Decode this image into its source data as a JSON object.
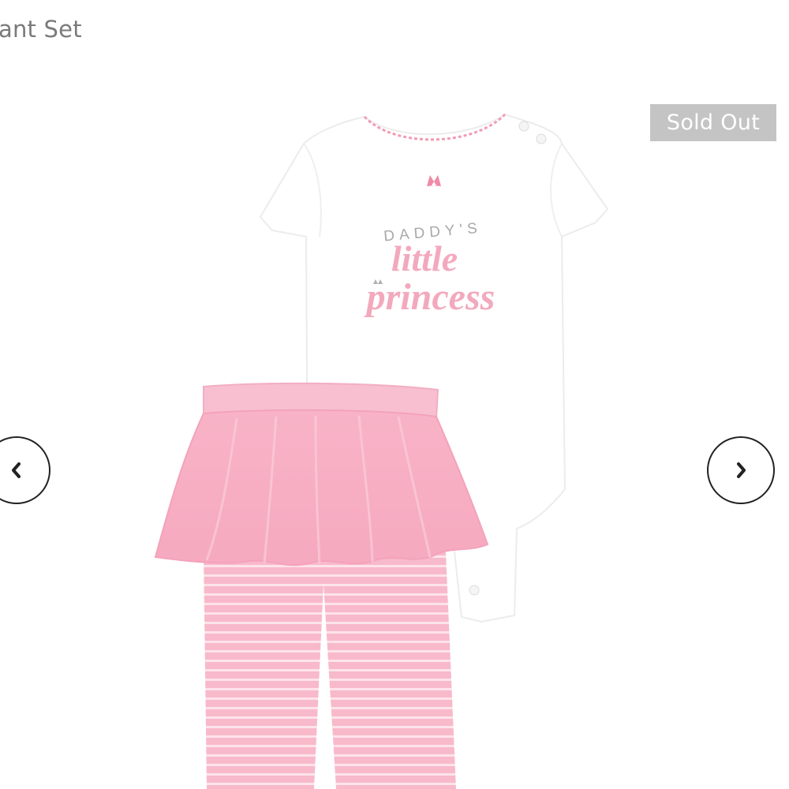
{
  "product": {
    "title": "ant Set",
    "badge": "Sold Out",
    "image_alt": "Daddy's little princess bodysuit with pink tutu pant"
  },
  "print": {
    "line1": "DADDY'S",
    "line2": "little",
    "line3": "princess"
  },
  "gallery": {
    "prev_icon": "chevron-left-icon",
    "next_icon": "chevron-right-icon"
  },
  "colors": {
    "badge_bg": "#c4c4c4",
    "title_text": "#7a7a7a",
    "pink_fabric": "#f7b6c8",
    "print_pink": "#f3a9bd"
  }
}
